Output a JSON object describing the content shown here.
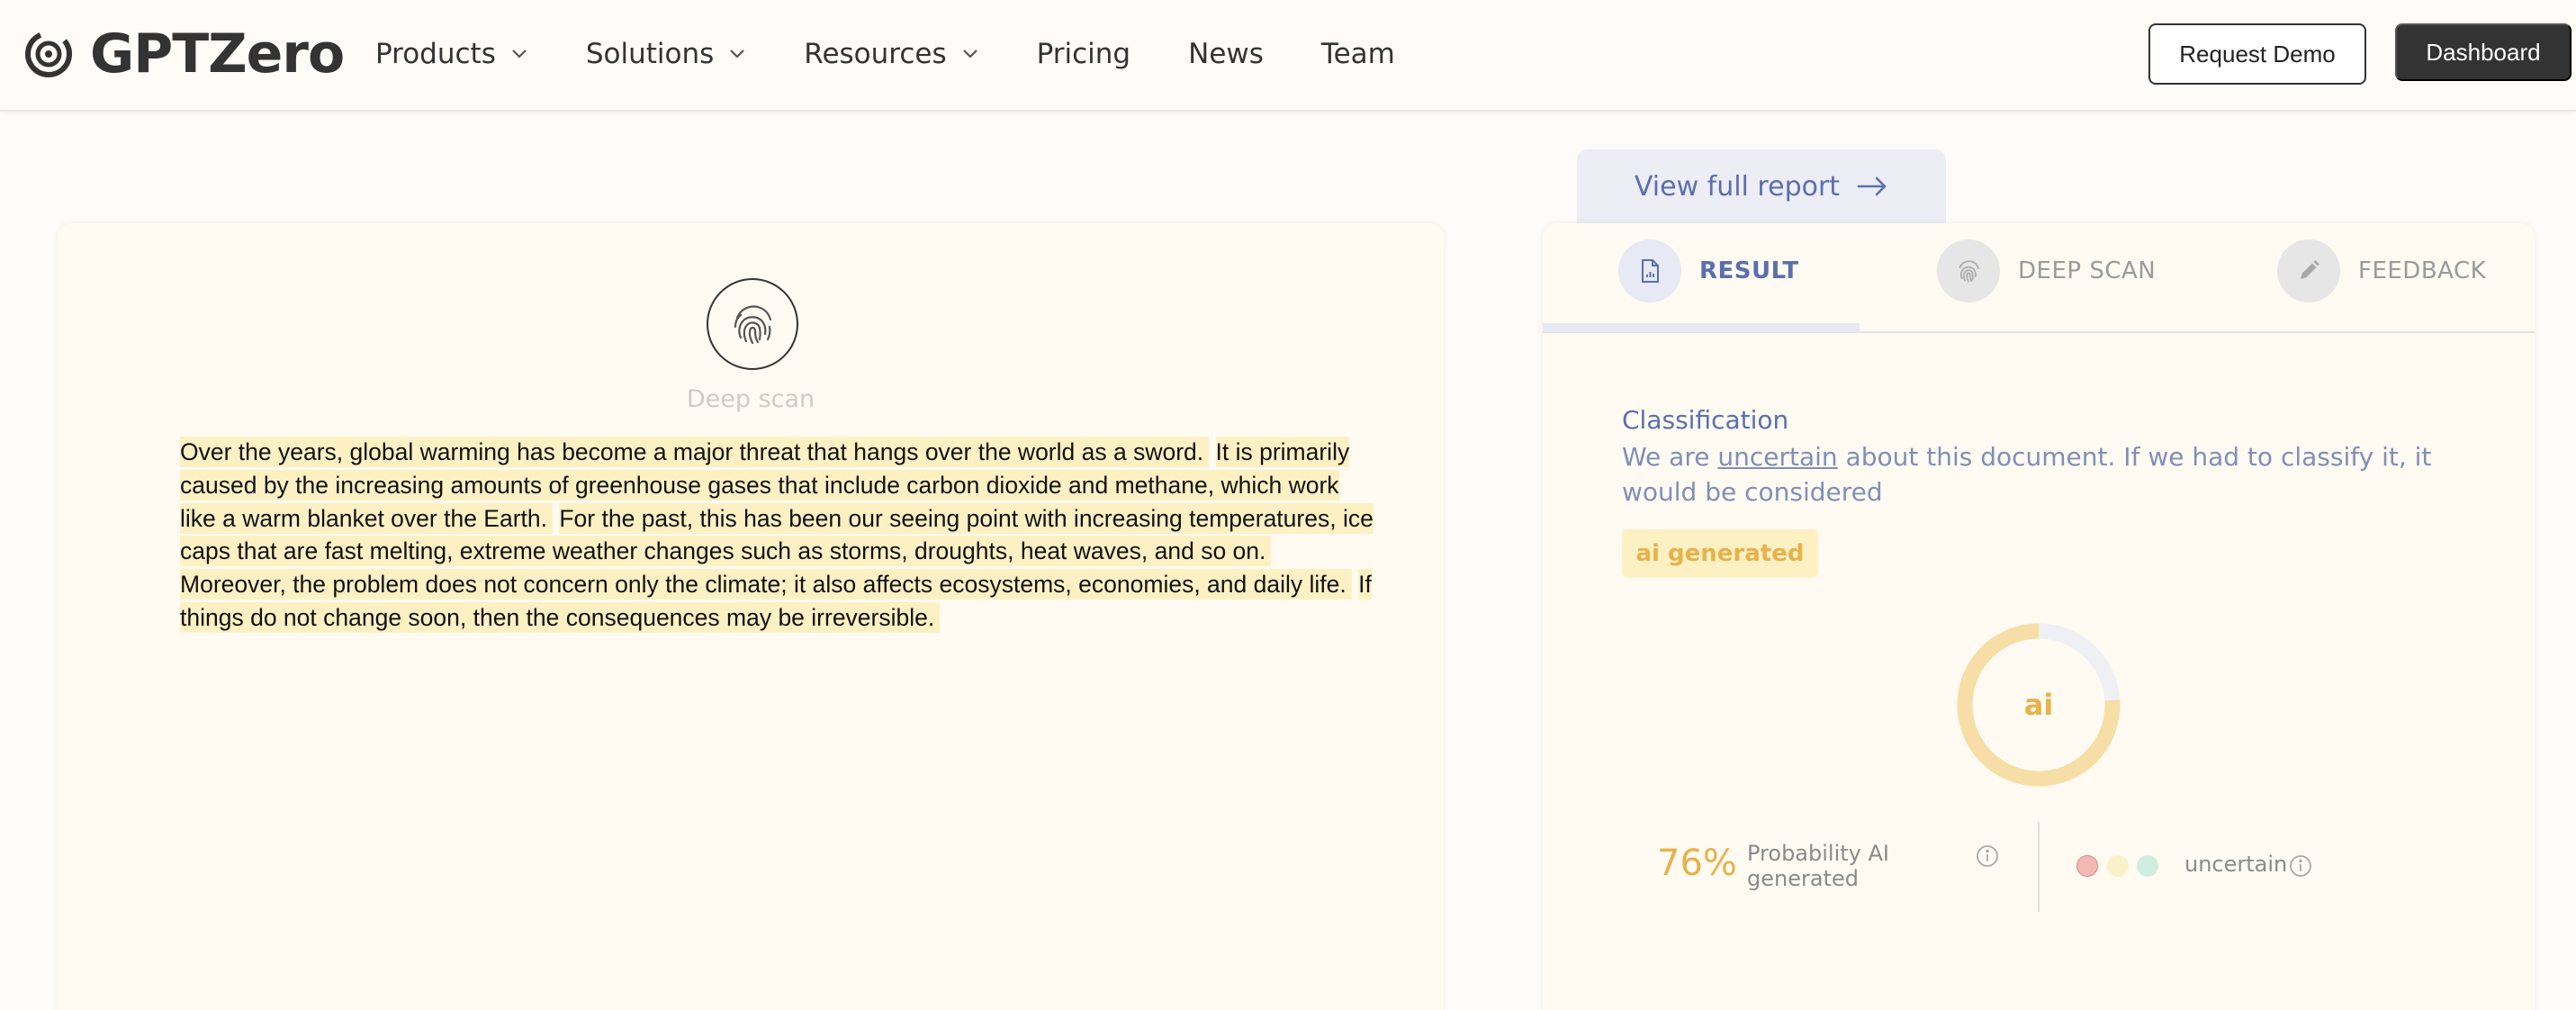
{
  "nav": {
    "logo_text": "GPTZero",
    "items": [
      {
        "label": "Products",
        "dropdown": true
      },
      {
        "label": "Solutions",
        "dropdown": true
      },
      {
        "label": "Resources",
        "dropdown": true
      },
      {
        "label": "Pricing",
        "dropdown": false
      },
      {
        "label": "News",
        "dropdown": false
      },
      {
        "label": "Team",
        "dropdown": false
      }
    ],
    "request_demo": "Request Demo",
    "dashboard": "Dashboard"
  },
  "scan_panel": {
    "icon": "fingerprint-icon",
    "label": "Deep scan",
    "sentences": [
      "Over the years, global warming has become a major threat that hangs over the world as a sword.",
      "It is primarily caused by the increasing amounts of greenhouse gases that include carbon dioxide and methane, which work like a warm blanket over the Earth.",
      "For the past, this has been our seeing point with increasing temperatures, ice caps that are fast melting, extreme weather changes such as storms, droughts, heat waves, and so on.",
      "Moreover, the problem does not concern only the climate; it also affects ecosystems, economies, and daily life.",
      "If things do not change soon, then the consequences may be irreversible."
    ]
  },
  "report": {
    "view_full_report": "View full report",
    "tabs": {
      "result": "RESULT",
      "deep_scan": "DEEP SCAN",
      "feedback": "FEEDBACK"
    },
    "classification_title": "Classification",
    "classification_prefix": "We are ",
    "classification_keyword": "uncertain",
    "classification_suffix": " about this document. If we had to classify it, it would be considered",
    "verdict": "ai generated",
    "donut_label": "ai",
    "donut_fraction": 0.76,
    "probability_value": "76%",
    "probability_label": "Probability AI generated",
    "confidence_label": "uncertain"
  },
  "colors": {
    "accent_blue": "#5a6fae",
    "ai_yellow": "#e8b14a",
    "highlight": "#fdf1c4",
    "donut_fill": "#f7dea6",
    "donut_track": "#eff0f3"
  }
}
